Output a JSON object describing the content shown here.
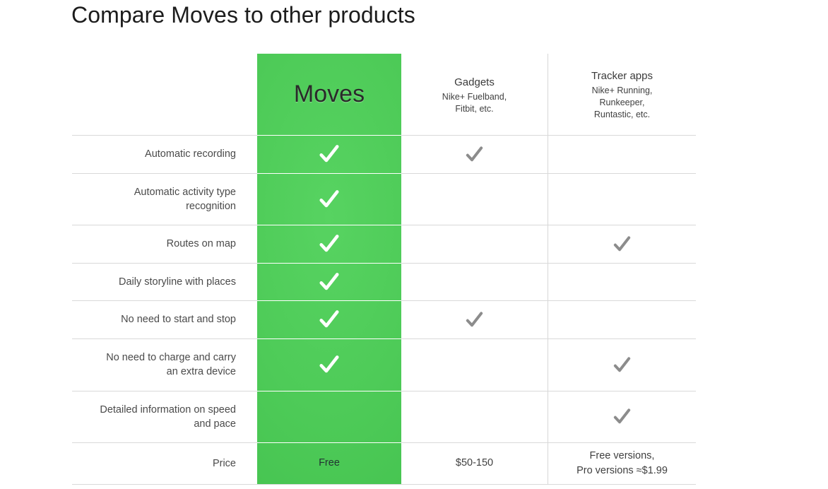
{
  "page": {
    "title": "Compare Moves to other products"
  },
  "colors": {
    "brand_green": "#4ECB58",
    "check_white": "#FFFFFF",
    "check_gray": "#8C8C8C",
    "grid_line": "#D9D9D9",
    "text": "#4A4A4A"
  },
  "table": {
    "columns": [
      {
        "key": "feature",
        "name": "",
        "sub": ""
      },
      {
        "key": "moves",
        "name": "Moves",
        "sub": ""
      },
      {
        "key": "gadgets",
        "name": "Gadgets",
        "sub": "Nike+ Fuelband,\nFitbit, etc."
      },
      {
        "key": "trackers",
        "name": "Tracker apps",
        "sub": "Nike+ Running,\nRunkeeper,\nRuntastic, etc."
      }
    ],
    "headers": {
      "moves": "Moves",
      "gadgets_name": "Gadgets",
      "gadgets_sub_line1": "Nike+ Fuelband,",
      "gadgets_sub_line2": "Fitbit, etc.",
      "trackers_name": "Tracker apps",
      "trackers_sub_line1": "Nike+ Running,",
      "trackers_sub_line2": "Runkeeper,",
      "trackers_sub_line3": "Runtastic, etc."
    },
    "rows": [
      {
        "label": "Automatic recording",
        "label_line1": "Automatic recording",
        "label_line2": "",
        "moves": "check",
        "gadgets": "check",
        "trackers": "none"
      },
      {
        "label": "Automatic activity type recognition",
        "label_line1": "Automatic activity type",
        "label_line2": "recognition",
        "moves": "check",
        "gadgets": "none",
        "trackers": "none"
      },
      {
        "label": "Routes on map",
        "label_line1": "Routes on map",
        "label_line2": "",
        "moves": "check",
        "gadgets": "none",
        "trackers": "check"
      },
      {
        "label": "Daily storyline with places",
        "label_line1": "Daily storyline with places",
        "label_line2": "",
        "moves": "check",
        "gadgets": "none",
        "trackers": "none"
      },
      {
        "label": "No need to start and stop",
        "label_line1": "No need to start and stop",
        "label_line2": "",
        "moves": "check",
        "gadgets": "check",
        "trackers": "none"
      },
      {
        "label": "No need to charge and carry an extra device",
        "label_line1": "No need to charge and carry",
        "label_line2": "an extra device",
        "moves": "check",
        "gadgets": "none",
        "trackers": "check"
      },
      {
        "label": "Detailed information on speed and pace",
        "label_line1": "Detailed information on speed",
        "label_line2": "and pace",
        "moves": "none",
        "gadgets": "none",
        "trackers": "check"
      },
      {
        "label": "Price",
        "label_line1": "Price",
        "label_line2": "",
        "moves": "Free",
        "gadgets": "$50-150",
        "trackers_line1": "Free versions,",
        "trackers_line2": "Pro versions ≈$1.99"
      }
    ]
  }
}
